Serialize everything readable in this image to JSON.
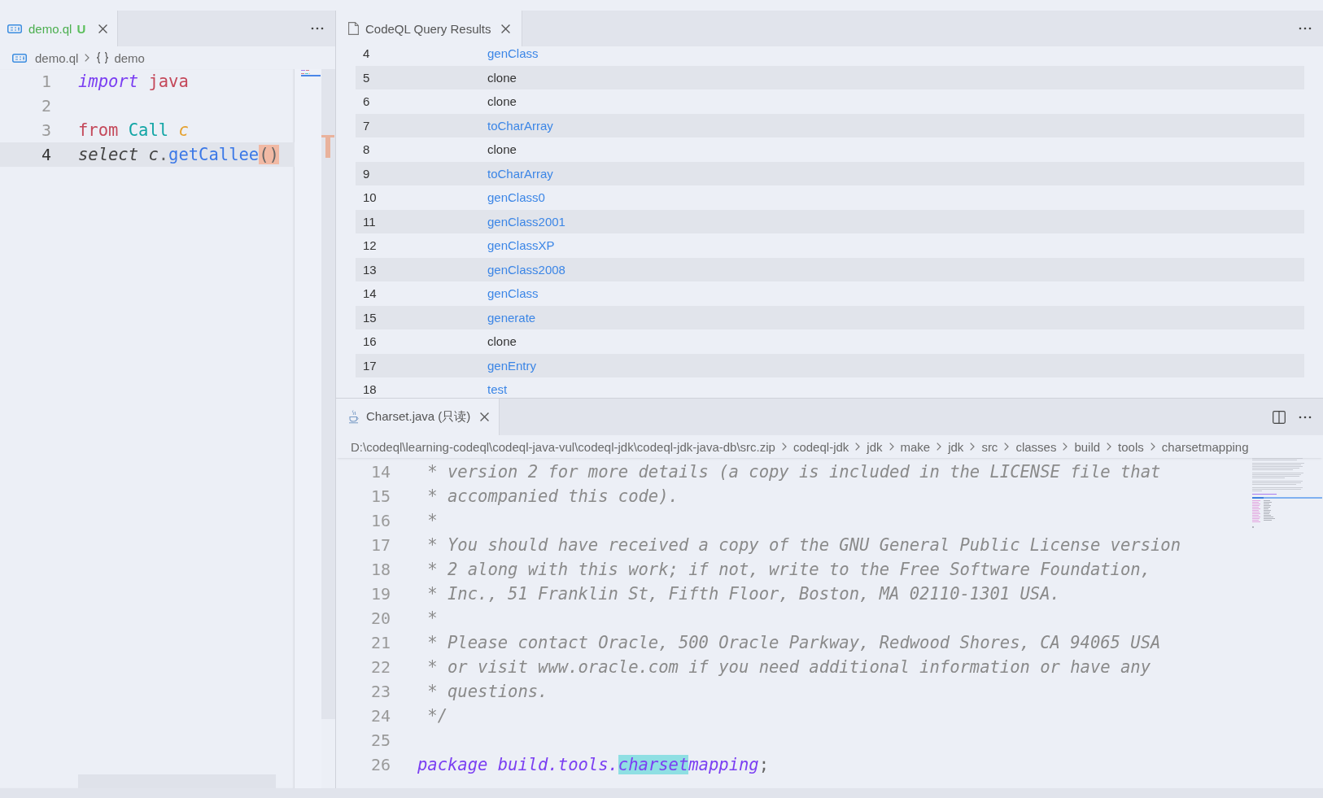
{
  "left_editor": {
    "tabs": [
      {
        "label": "demo.ql",
        "untracked": true,
        "badge": "U",
        "selected": true
      }
    ],
    "breadcrumb": [
      {
        "kind": "file",
        "label": "demo.ql"
      },
      {
        "kind": "module",
        "label": "demo"
      }
    ],
    "lines": [
      {
        "number": "1",
        "current": false,
        "tokens": [
          {
            "kind": "keyword",
            "text": "import"
          },
          {
            "kind": "keyword-alt",
            "text": " java"
          }
        ]
      },
      {
        "number": "2",
        "current": false
      },
      {
        "number": "3",
        "current": false,
        "tokens": [
          {
            "kind": "keyword-alt",
            "text": "from"
          },
          {
            "kind": "type",
            "text": " Call"
          },
          {
            "kind": "variable",
            "text": " c"
          }
        ]
      },
      {
        "number": "4",
        "current": true,
        "tokens": [
          {
            "kind": "italic",
            "text": "select"
          },
          {
            "kind": "italic",
            "text": " c"
          },
          {
            "kind": "punct",
            "text": "."
          },
          {
            "kind": "function",
            "text": "getCallee"
          },
          {
            "kind": "punct",
            "text": "()",
            "bracket_match": true
          }
        ]
      }
    ]
  },
  "results": {
    "tabs": [
      {
        "label": "CodeQL Query Results",
        "selected": true
      }
    ],
    "rows": [
      {
        "index": "4",
        "name": "genClass",
        "linked": true
      },
      {
        "index": "5",
        "name": "clone",
        "linked": false
      },
      {
        "index": "6",
        "name": "clone",
        "linked": false
      },
      {
        "index": "7",
        "name": "toCharArray",
        "linked": true
      },
      {
        "index": "8",
        "name": "clone",
        "linked": false
      },
      {
        "index": "9",
        "name": "toCharArray",
        "linked": true
      },
      {
        "index": "10",
        "name": "genClass0",
        "linked": true
      },
      {
        "index": "11",
        "name": "genClass2001",
        "linked": true
      },
      {
        "index": "12",
        "name": "genClassXP",
        "linked": true
      },
      {
        "index": "13",
        "name": "genClass2008",
        "linked": true
      },
      {
        "index": "14",
        "name": "genClass",
        "linked": true
      },
      {
        "index": "15",
        "name": "generate",
        "linked": true
      },
      {
        "index": "16",
        "name": "clone",
        "linked": false
      },
      {
        "index": "17",
        "name": "genEntry",
        "linked": true
      },
      {
        "index": "18",
        "name": "test",
        "linked": true
      }
    ]
  },
  "source_editor": {
    "tabs": [
      {
        "label": "Charset.java (只读)",
        "selected": true
      }
    ],
    "breadcrumb": [
      "D:\\codeql\\learning-codeql\\codeql-java-vul\\codeql-jdk\\codeql-jdk-java-db\\src.zip",
      "codeql-jdk",
      "jdk",
      "make",
      "jdk",
      "src",
      "classes",
      "build",
      "tools",
      "charsetmapping"
    ],
    "lines": [
      {
        "number": "14",
        "tokens": [
          {
            "kind": "comment",
            "text": " * version 2 for more details (a copy is included in the LICENSE file that"
          }
        ]
      },
      {
        "number": "15",
        "tokens": [
          {
            "kind": "comment",
            "text": " * accompanied this code)."
          }
        ]
      },
      {
        "number": "16",
        "tokens": [
          {
            "kind": "comment",
            "text": " *"
          }
        ]
      },
      {
        "number": "17",
        "tokens": [
          {
            "kind": "comment",
            "text": " * You should have received a copy of the GNU General Public License version"
          }
        ]
      },
      {
        "number": "18",
        "tokens": [
          {
            "kind": "comment",
            "text": " * 2 along with this work; if not, write to the Free Software Foundation,"
          }
        ]
      },
      {
        "number": "19",
        "tokens": [
          {
            "kind": "comment",
            "text": " * Inc., 51 Franklin St, Fifth Floor, Boston, MA 02110-1301 USA."
          }
        ]
      },
      {
        "number": "20",
        "tokens": [
          {
            "kind": "comment",
            "text": " *"
          }
        ]
      },
      {
        "number": "21",
        "tokens": [
          {
            "kind": "comment",
            "text": " * Please contact Oracle, 500 Oracle Parkway, Redwood Shores, CA 94065 USA"
          }
        ]
      },
      {
        "number": "22",
        "tokens": [
          {
            "kind": "comment",
            "text": " * or visit www.oracle.com if you need additional information or have any"
          }
        ]
      },
      {
        "number": "23",
        "tokens": [
          {
            "kind": "comment",
            "text": " * questions."
          }
        ]
      },
      {
        "number": "24",
        "tokens": [
          {
            "kind": "comment",
            "text": " */"
          }
        ]
      },
      {
        "number": "25"
      },
      {
        "number": "26",
        "tokens": [
          {
            "kind": "keyword",
            "text": "package"
          },
          {
            "kind": "namespace",
            "text": " build.tools."
          },
          {
            "kind": "namespace",
            "text": "charset",
            "word_highlight": true
          },
          {
            "kind": "namespace",
            "text": "mapping"
          },
          {
            "kind": "punct",
            "text": ";"
          }
        ]
      }
    ]
  }
}
